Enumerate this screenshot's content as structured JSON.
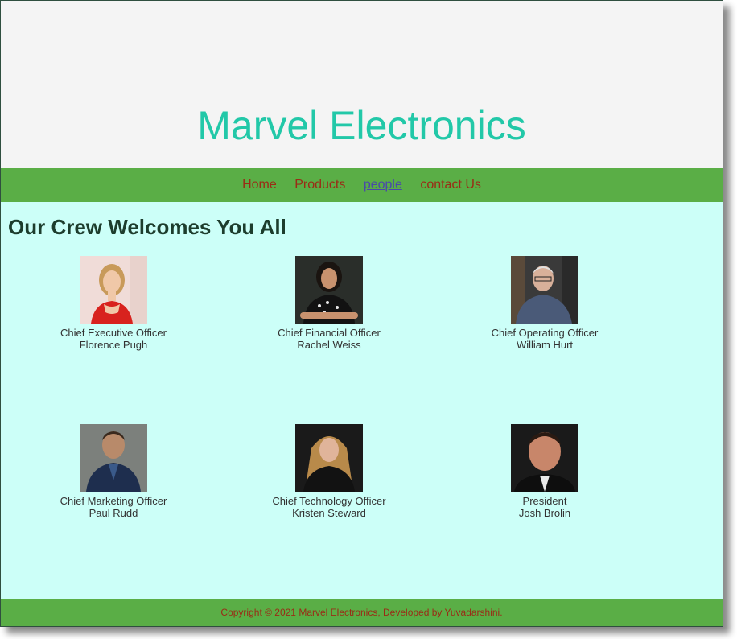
{
  "header": {
    "title": "Marvel Electronics"
  },
  "nav": {
    "items": [
      {
        "label": "Home"
      },
      {
        "label": "Products"
      },
      {
        "label": "people"
      },
      {
        "label": "contact Us"
      }
    ]
  },
  "main": {
    "heading": "Our Crew Welcomes You All",
    "crew": [
      {
        "role": "Chief Executive Officer",
        "name": "Florence Pugh"
      },
      {
        "role": "Chief Financial Officer",
        "name": "Rachel Weiss"
      },
      {
        "role": "Chief Operating Officer",
        "name": "William Hurt"
      },
      {
        "role": "Chief Marketing Officer",
        "name": "Paul Rudd"
      },
      {
        "role": "Chief Technology Officer",
        "name": "Kristen Steward"
      },
      {
        "role": "President",
        "name": "Josh Brolin"
      }
    ]
  },
  "footer": {
    "text": "Copyright © 2021 Marvel Electronics, Developed by Yuvadarshini."
  },
  "colors": {
    "title": "#22c8a8",
    "nav_bg": "#5aae46",
    "nav_link": "#9a2c16",
    "nav_active": "#4a4aa8",
    "content_bg": "#ccfff8",
    "header_bg": "#f4f4f4"
  }
}
